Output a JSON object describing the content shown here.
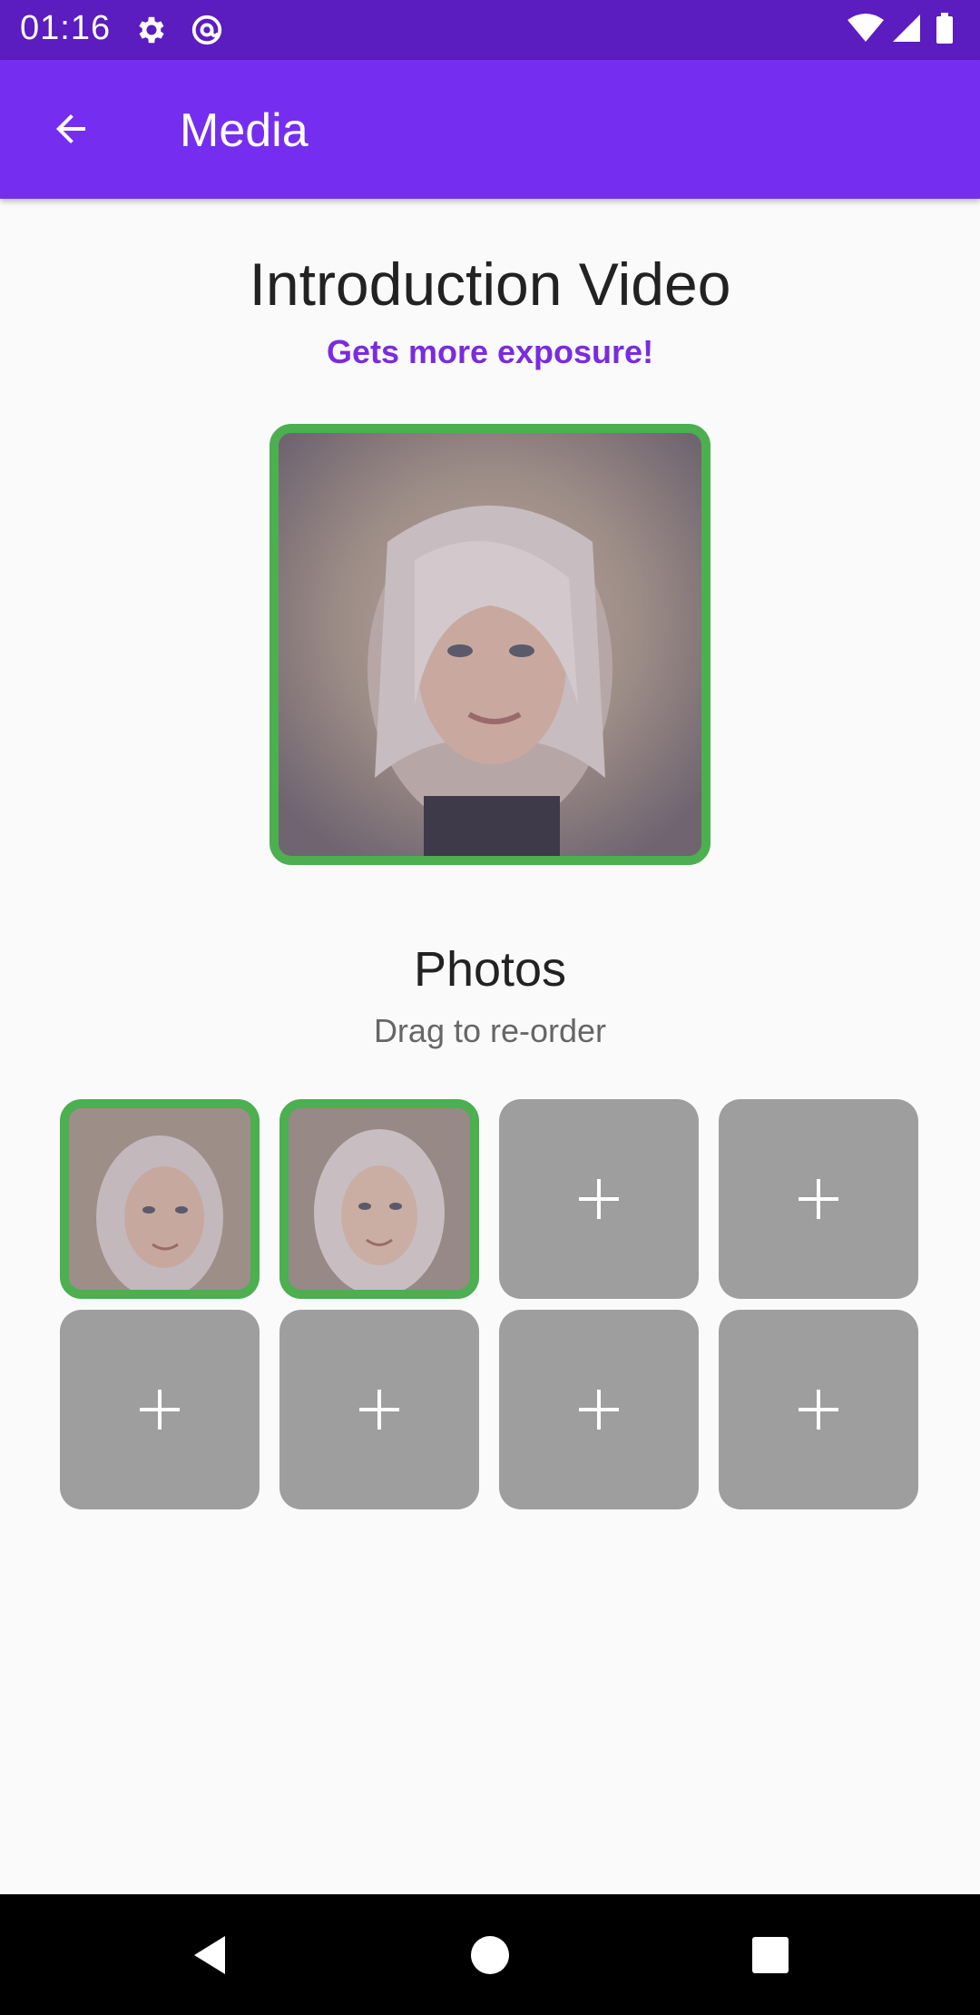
{
  "status_bar": {
    "time": "01:16",
    "icons_left": [
      "gear-icon",
      "at-sign-icon"
    ],
    "icons_right": [
      "wifi-icon",
      "signal-icon",
      "battery-icon"
    ]
  },
  "app_bar": {
    "title": "Media",
    "back_icon": "arrow-back-icon"
  },
  "intro": {
    "title": "Introduction Video",
    "subtitle": "Gets more exposure!"
  },
  "photos": {
    "title": "Photos",
    "subtitle": "Drag to re-order",
    "tiles": [
      {
        "type": "photo"
      },
      {
        "type": "photo"
      },
      {
        "type": "add"
      },
      {
        "type": "add"
      },
      {
        "type": "add"
      },
      {
        "type": "add"
      },
      {
        "type": "add"
      },
      {
        "type": "add"
      }
    ]
  },
  "nav_bar": {
    "buttons": [
      "back-triangle-icon",
      "home-circle-icon",
      "recents-square-icon"
    ]
  },
  "colors": {
    "status_bar": "#5b1cc0",
    "app_bar": "#752ef0",
    "accent_text": "#7a2be0",
    "photo_border": "#4caf50",
    "empty_tile": "#9e9e9e",
    "background": "#fafafa"
  }
}
